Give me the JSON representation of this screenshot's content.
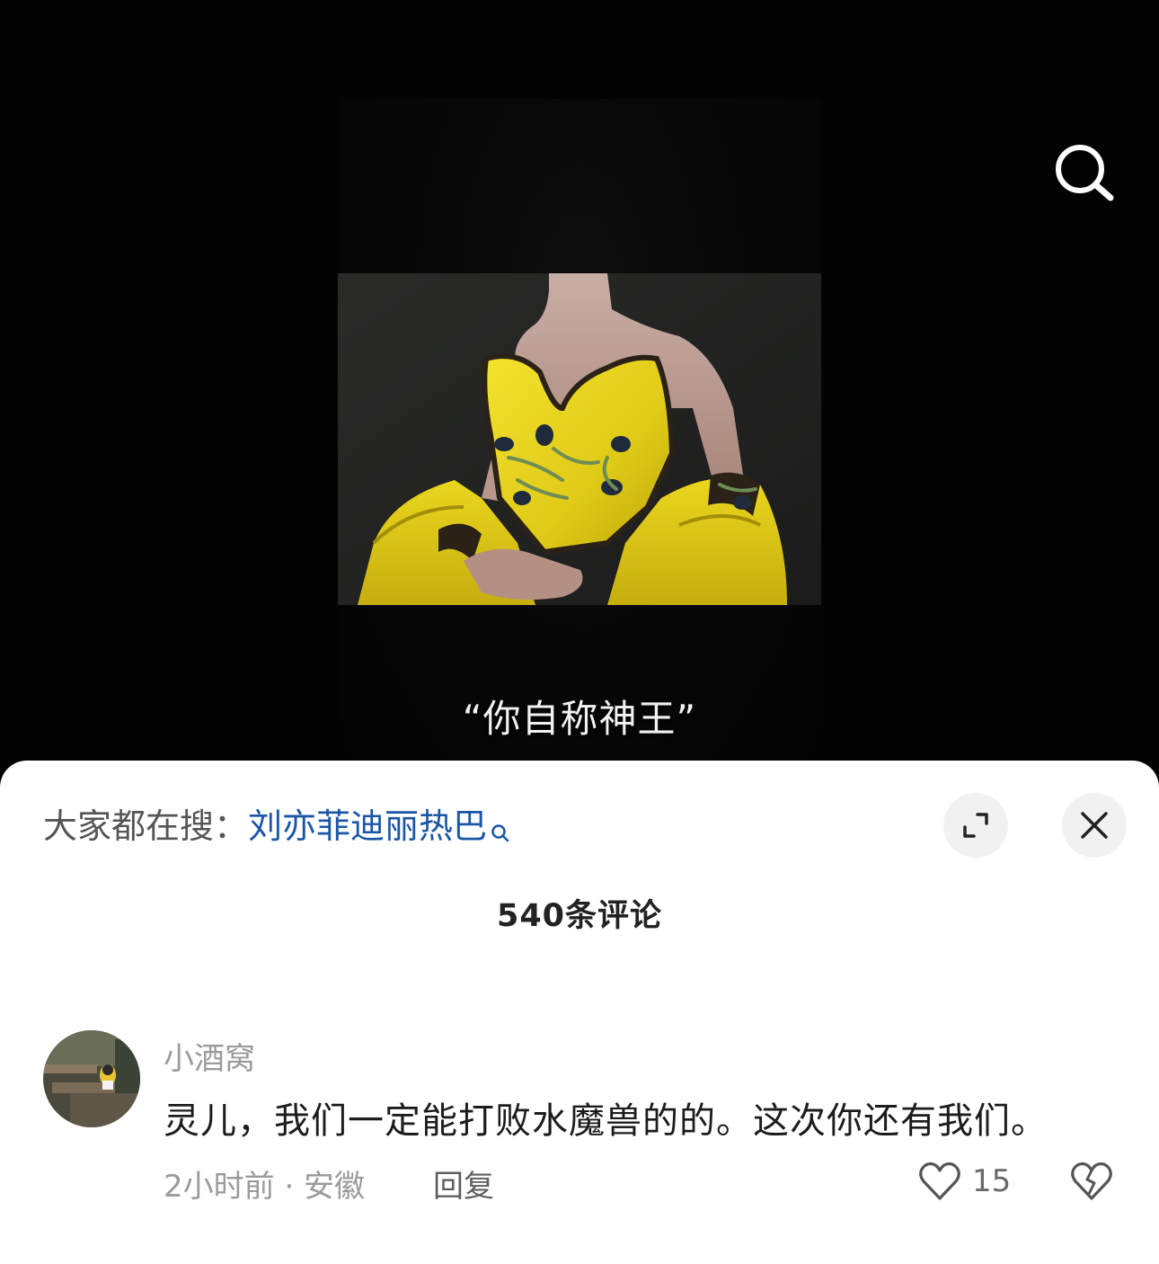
{
  "video": {
    "subtitle": "“你自称神王”",
    "search_icon": "search-icon"
  },
  "sheet": {
    "hot_search_prefix": "大家都在搜：",
    "hot_search_term": "刘亦菲迪丽热巴",
    "expand_icon": "expand-icon",
    "close_icon": "close-icon",
    "comment_count_title": "540条评论"
  },
  "comments": [
    {
      "username": "小酒窝",
      "text": "灵儿，我们一定能打败水魔兽的的。这次你还有我们。",
      "time_location": "2小时前 · 安徽",
      "reply_label": "回复",
      "like_count": "15",
      "like_icon": "heart-outline-icon",
      "dislike_icon": "broken-heart-icon"
    }
  ],
  "colors": {
    "link": "#1a56a8",
    "dress_yellow": "#e8d41c",
    "sheet_bg": "#ffffff",
    "button_bg": "#f1f1f1"
  }
}
